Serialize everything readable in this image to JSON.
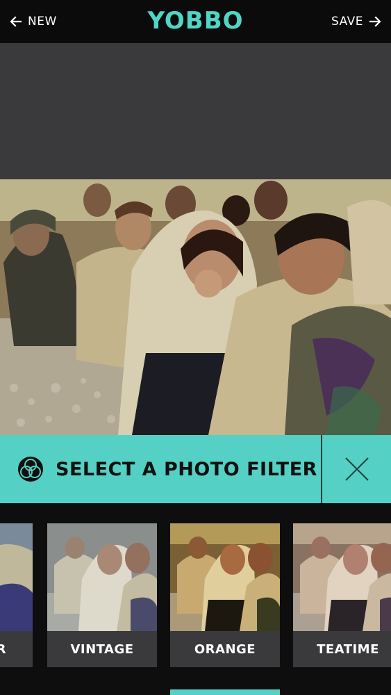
{
  "header": {
    "back_label": "NEW",
    "logo": "YOBBO",
    "save_label": "SAVE",
    "accent_color": "#4fd6c6"
  },
  "filter_bar": {
    "title": "SELECT A PHOTO FILTER",
    "icon": "color-filter-icon",
    "close_icon": "close-icon"
  },
  "filters": {
    "items": [
      {
        "label": "R",
        "icon": "photo-thumbnail"
      },
      {
        "label": "VINTAGE",
        "icon": "photo-thumbnail"
      },
      {
        "label": "ORANGE",
        "icon": "photo-thumbnail"
      },
      {
        "label": "TEATIME",
        "icon": "photo-thumbnail"
      }
    ],
    "selected": "ORANGE"
  }
}
